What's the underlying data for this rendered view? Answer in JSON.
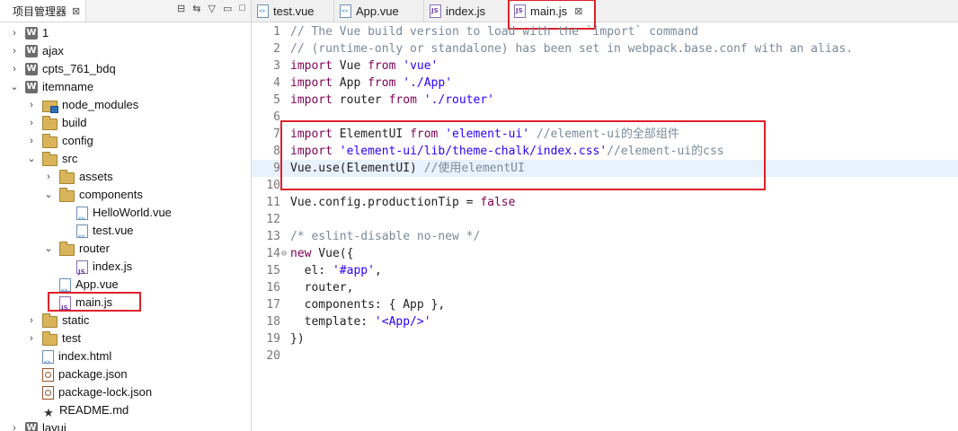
{
  "explorer": {
    "title": "项目管理器",
    "close": "⊠",
    "items": [
      {
        "label": "1",
        "arrow": "›",
        "icon": "project"
      },
      {
        "label": "ajax",
        "arrow": "›",
        "icon": "project"
      },
      {
        "label": "cpts_761_bdq",
        "arrow": "›",
        "icon": "project"
      },
      {
        "label": "itemname",
        "arrow": "⌄",
        "icon": "project"
      },
      {
        "label": "node_modules",
        "arrow": "›",
        "icon": "node-modules"
      },
      {
        "label": "build",
        "arrow": "›",
        "icon": "folder"
      },
      {
        "label": "config",
        "arrow": "›",
        "icon": "folder"
      },
      {
        "label": "src",
        "arrow": "⌄",
        "icon": "folder"
      },
      {
        "label": "assets",
        "arrow": "›",
        "icon": "folder"
      },
      {
        "label": "components",
        "arrow": "⌄",
        "icon": "folder"
      },
      {
        "label": "HelloWorld.vue",
        "arrow": "",
        "icon": "vue"
      },
      {
        "label": "test.vue",
        "arrow": "",
        "icon": "vue"
      },
      {
        "label": "router",
        "arrow": "⌄",
        "icon": "folder"
      },
      {
        "label": "index.js",
        "arrow": "",
        "icon": "js"
      },
      {
        "label": "App.vue",
        "arrow": "",
        "icon": "vue"
      },
      {
        "label": "main.js",
        "arrow": "",
        "icon": "js"
      },
      {
        "label": "static",
        "arrow": "›",
        "icon": "folder"
      },
      {
        "label": "test",
        "arrow": "›",
        "icon": "folder"
      },
      {
        "label": "index.html",
        "arrow": "",
        "icon": "vue"
      },
      {
        "label": "package.json",
        "arrow": "",
        "icon": "json"
      },
      {
        "label": "package-lock.json",
        "arrow": "",
        "icon": "json"
      },
      {
        "label": "README.md",
        "arrow": "",
        "icon": "star"
      },
      {
        "label": "layui",
        "arrow": "›",
        "icon": "project"
      }
    ]
  },
  "tabs": [
    {
      "label": "test.vue",
      "icon": "vue"
    },
    {
      "label": "App.vue",
      "icon": "vue"
    },
    {
      "label": "index.js",
      "icon": "js"
    },
    {
      "label": "main.js",
      "icon": "js",
      "active": true,
      "close": "⊠"
    }
  ],
  "code": {
    "lines": [
      {
        "n": "1",
        "html": "<span class='com'>// The Vue build version to load with the `import` command</span>"
      },
      {
        "n": "2",
        "html": "<span class='com'>// (runtime-only or standalone) has been set in webpack.base.conf with an alias.</span>"
      },
      {
        "n": "3",
        "html": "<span class='kw'>import</span> Vue <span class='kw'>from</span> <span class='str'>'vue'</span>"
      },
      {
        "n": "4",
        "html": "<span class='kw'>import</span> App <span class='kw'>from</span> <span class='str'>'./App'</span>"
      },
      {
        "n": "5",
        "html": "<span class='kw'>import</span> router <span class='kw'>from</span> <span class='str'>'./router'</span>"
      },
      {
        "n": "6",
        "html": ""
      },
      {
        "n": "7",
        "html": "<span class='kw'>import</span> ElementUI <span class='kw'>from</span> <span class='str'>'element-ui'</span> <span class='com'>//element-ui的全部组件</span>"
      },
      {
        "n": "8",
        "html": "<span class='kw'>import</span> <span class='str'>'element-ui/lib/theme-chalk/index.css'</span><span class='com'>//element-ui的css</span>"
      },
      {
        "n": "9",
        "html": "Vue.use(ElementUI) <span class='com'>//使用elementUI</span>",
        "current": true
      },
      {
        "n": "10",
        "html": ""
      },
      {
        "n": "11",
        "html": "Vue.config.productionTip = <span class='const'>false</span>"
      },
      {
        "n": "12",
        "html": ""
      },
      {
        "n": "13",
        "html": "<span class='com'>/* eslint-disable no-new */</span>"
      },
      {
        "n": "14",
        "html": "<span class='kw'>new</span> Vue({",
        "fold": "⊖"
      },
      {
        "n": "15",
        "html": "  el: <span class='str'>'#app'</span>,"
      },
      {
        "n": "16",
        "html": "  router,"
      },
      {
        "n": "17",
        "html": "  components: { App },"
      },
      {
        "n": "18",
        "html": "  template: <span class='str'>'&lt;App/&gt;'</span>"
      },
      {
        "n": "19",
        "html": "})"
      },
      {
        "n": "20",
        "html": ""
      }
    ]
  },
  "colors": {
    "highlight_box": "#e0202a",
    "current_line": "#e8f2fe",
    "keyword": "#7f0055",
    "string": "#2a00ff",
    "comment": "#7a8a9a"
  }
}
